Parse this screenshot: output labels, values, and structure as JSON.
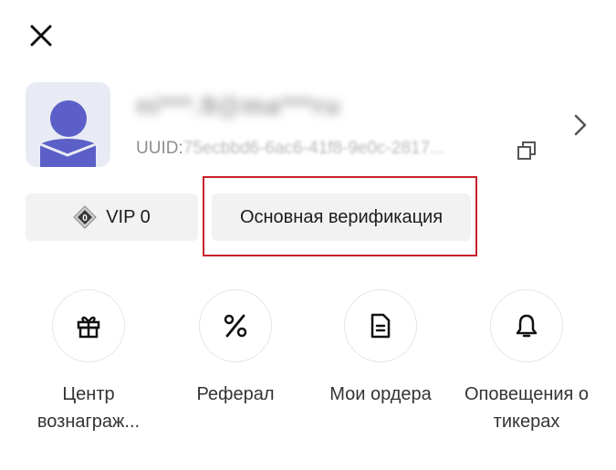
{
  "header": {
    "close_icon": "close-icon"
  },
  "profile": {
    "email": "ni***.9@ma***ru",
    "uuid_label": "UUID:",
    "uuid_value": "75ecbbd6-6ac6-41f8-9e0c-2817...",
    "avatar_color": "#5b5fc7",
    "copy_icon": "copy-icon",
    "chevron_icon": "chevron-right-icon"
  },
  "badges": {
    "vip_label": "VIP 0",
    "vip_level": "0",
    "verification_label": "Основная верификация",
    "highlight_color": "#c9202a"
  },
  "actions": [
    {
      "icon": "gift-icon",
      "label": "Центр вознаграж..."
    },
    {
      "icon": "percent-icon",
      "label": "Реферал"
    },
    {
      "icon": "document-icon",
      "label": "Мои ордера"
    },
    {
      "icon": "bell-icon",
      "label": "Оповещения о тикерах"
    }
  ]
}
